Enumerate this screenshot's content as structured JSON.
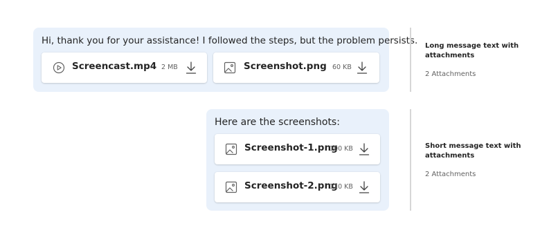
{
  "messages": [
    {
      "text": "Hi, thank you for your assistance! I followed the steps, but the problem persists.",
      "attachments": [
        {
          "icon": "play-icon",
          "name": "Screencast.mp4",
          "size": "2 MB"
        },
        {
          "icon": "image-icon",
          "name": "Screenshot.png",
          "size": "60 KB"
        }
      ]
    },
    {
      "text": "Here are the screenshots:",
      "attachments": [
        {
          "icon": "image-icon",
          "name": "Screenshot-1.png",
          "size": "100 KB"
        },
        {
          "icon": "image-icon",
          "name": "Screenshot-2.png",
          "size": "110 KB"
        }
      ]
    }
  ],
  "annotations": [
    {
      "title": "Long message text with attachments",
      "subtitle": "2 Attachments"
    },
    {
      "title": "Short message text with attachments",
      "subtitle": "2 Attachments"
    }
  ],
  "colors": {
    "bubble": "#e9f1fb",
    "card": "#ffffff",
    "divider": "#d6d6d6",
    "icon": "#616161"
  }
}
